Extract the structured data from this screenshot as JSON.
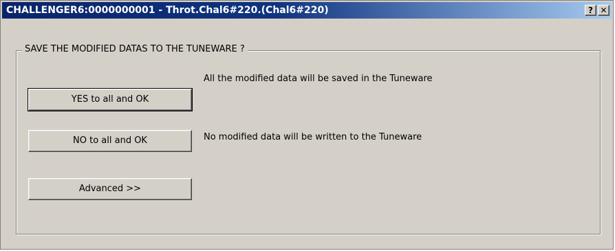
{
  "window": {
    "title": "CHALLENGER6:0000000001 - Throt.Chal6#220.(Chal6#220)",
    "help_button": "?",
    "close_button": "✕"
  },
  "group": {
    "legend": "SAVE THE MODIFIED DATAS TO THE TUNEWARE ?"
  },
  "options": {
    "yes_button": "YES to all and OK",
    "yes_description": "All the modified data will be saved in the Tuneware",
    "no_button": "NO to all and OK",
    "no_description": "No modified data will be written to the Tuneware",
    "advanced_button": "Advanced >>"
  }
}
